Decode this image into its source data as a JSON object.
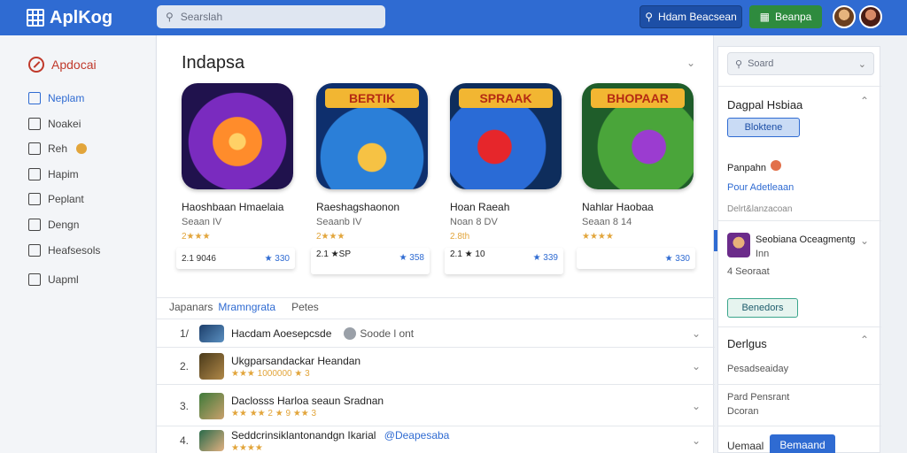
{
  "app": {
    "title": "AplKog"
  },
  "header": {
    "search_placeholder": "Searslah",
    "btn_primary": "Hdam Beacsean",
    "btn_secondary": "Beanpa"
  },
  "sidebar": {
    "home": "Apdocai",
    "items": [
      {
        "label": "Neplam",
        "active": true
      },
      {
        "label": "Noakei"
      },
      {
        "label": "Reh"
      },
      {
        "label": "Hapim"
      },
      {
        "label": "Peplant"
      },
      {
        "label": "Dengn"
      },
      {
        "label": "Heafsesols"
      },
      {
        "label": "Uapml"
      }
    ]
  },
  "main": {
    "title": "Indapsa",
    "cards": [
      {
        "name": "Haoshbaan Hmaelaia",
        "sub": "Seaan IV",
        "rating": "2★★★",
        "price_left": "2.1 9046",
        "price_right": "★ 330"
      },
      {
        "name": "Raeshagshaonon",
        "sub": "Seaanb IV",
        "rating": "2★★★",
        "price_left": "2.1 ★SP",
        "price_right": "★ 358",
        "banner": "BERTIK"
      },
      {
        "name": "Hoan Raeah",
        "sub": "Noan 8 DV",
        "rating": "2.8th",
        "price_left": "2.1 ★ 10",
        "price_right": "★ 339",
        "banner": "SPRAAK"
      },
      {
        "name": "Nahlar Haobaa",
        "sub": "Seaan 8 14",
        "rating": "★★★★",
        "price_left": "",
        "price_right": "★ 330",
        "banner": "BHOPAAR"
      }
    ],
    "tabs": [
      "Japanars",
      "Mramngrata",
      "Petes"
    ],
    "rows": [
      {
        "num": "1/",
        "title": "Hacdam Aoesepcsde",
        "extra": "Soode l ont",
        "sub": ""
      },
      {
        "num": "2.",
        "title": "Ukgparsandackar Heandan",
        "extra": "",
        "sub": "★★★ 1000000 ★ 3"
      },
      {
        "num": "3.",
        "title": "Daclosss Harloa seaun  Sradnan",
        "extra": "",
        "sub": "★★ ★★ 2 ★ 9 ★★ 3"
      },
      {
        "num": "4.",
        "title": "Seddcrinsiklantonandgn Ikarial",
        "extra": "@Deapesaba",
        "sub": "★★★★"
      }
    ]
  },
  "right": {
    "search_placeholder": "Soard",
    "section1_title": "Dagpal Hsbiaa",
    "section1_button": "Bloktene",
    "section1_item": "Panpahn",
    "section1_link": "Pour Adetleaan",
    "section1_meta": "Delrt&lanzacoan",
    "profile_title": "Seobiana Oceagmentg",
    "profile_sub": "Inn",
    "profile_meta": "4 Seoraat",
    "profile_button": "Benedors",
    "section2_title": "Derlgus",
    "section2_item": "Pesadseaiday",
    "section2_foot1": "Pard Pensrant",
    "section2_foot2": "Dcoran",
    "footer_label": "Uemaal",
    "footer_button": "Bemaand"
  }
}
